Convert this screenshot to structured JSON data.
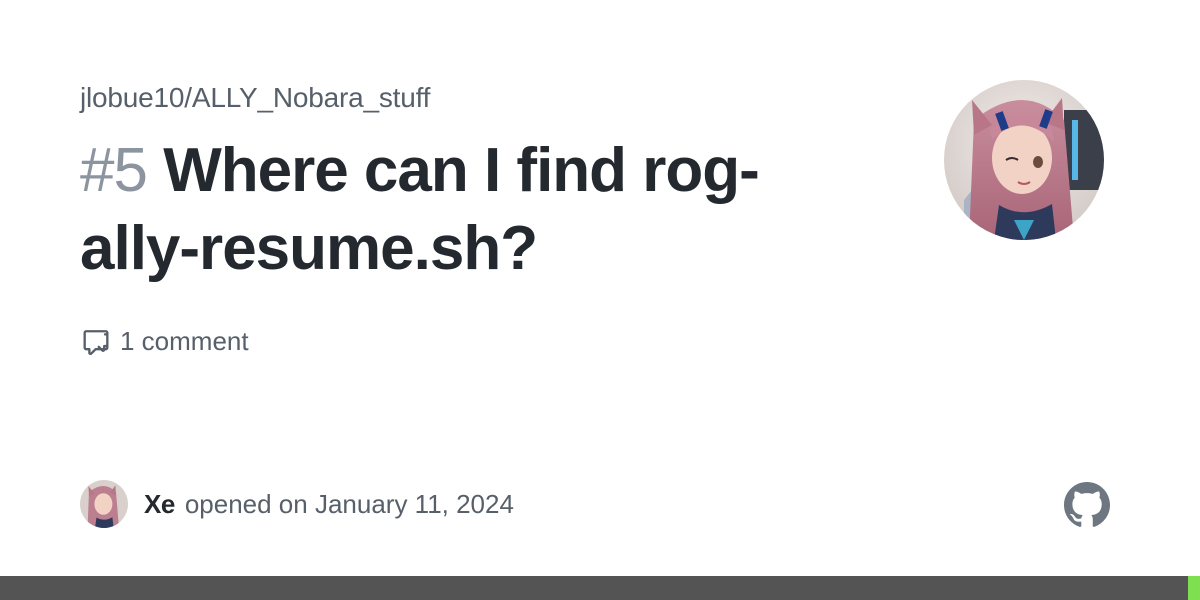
{
  "repo": {
    "name": "jlobue10/ALLY_Nobara_stuff"
  },
  "issue": {
    "number": "#5",
    "title": "Where can I find rog-ally-resume.sh?"
  },
  "comments": {
    "label": "1 comment",
    "icon": "comment-discussion-icon"
  },
  "author": {
    "name": "Xe",
    "action": "opened on January 11, 2024",
    "avatar": "avatar-anime-character"
  },
  "brand": {
    "icon": "github-logo-icon",
    "icon_color": "#6e7781"
  },
  "colors": {
    "title": "#24292f",
    "muted": "#57606a",
    "number": "#8c959f",
    "footer_bar": "#545454",
    "footer_accent": "#7ee051"
  }
}
